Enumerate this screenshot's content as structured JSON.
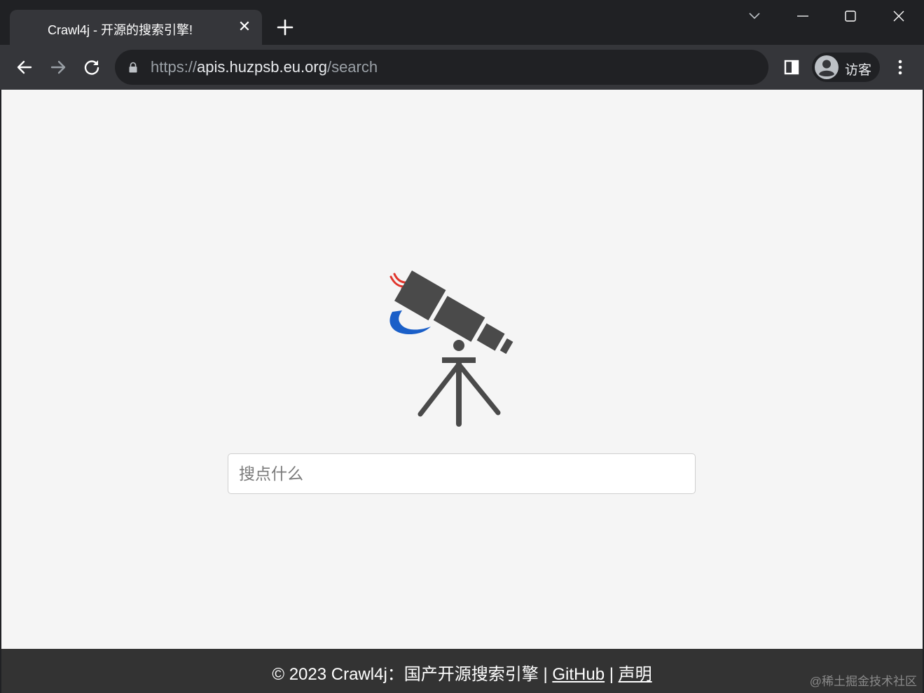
{
  "browser": {
    "tab": {
      "title": "Crawl4j - 开源的搜索引擎!",
      "close_glyph": "✕"
    },
    "icons": {
      "new_tab": "plus-icon",
      "tab_search": "chevron-down-icon",
      "minimize": "minimize-icon",
      "maximize": "maximize-icon",
      "close_window": "close-icon",
      "back": "arrow-left-icon",
      "forward": "arrow-right-icon",
      "reload": "reload-icon",
      "lock": "lock-icon",
      "side_panel": "side-panel-icon",
      "avatar": "avatar-icon",
      "menu": "more-vert-icon"
    },
    "address_bar": {
      "scheme": "https://",
      "host": "apis.huzpsb.eu.org",
      "path": "/search"
    },
    "profile": {
      "label": "访客"
    }
  },
  "page": {
    "logo_name": "telescope-logo-icon",
    "search": {
      "placeholder": "搜点什么",
      "value": ""
    },
    "footer": {
      "copyright": "© 2023 Crawl4j：国产开源搜索引擎",
      "separator_1": " | ",
      "github_link": "GitHub",
      "separator_2": " | ",
      "statement_link": "声明"
    },
    "watermark": "@稀土掘金技术社区"
  },
  "colors": {
    "frame_dark": "#202124",
    "toolbar": "#35363a",
    "page_bg": "#f5f5f5",
    "footer_bg": "#333333",
    "logo_gray": "#4a4a4a",
    "logo_blue": "#1a5fc8",
    "logo_red": "#e0342b"
  }
}
